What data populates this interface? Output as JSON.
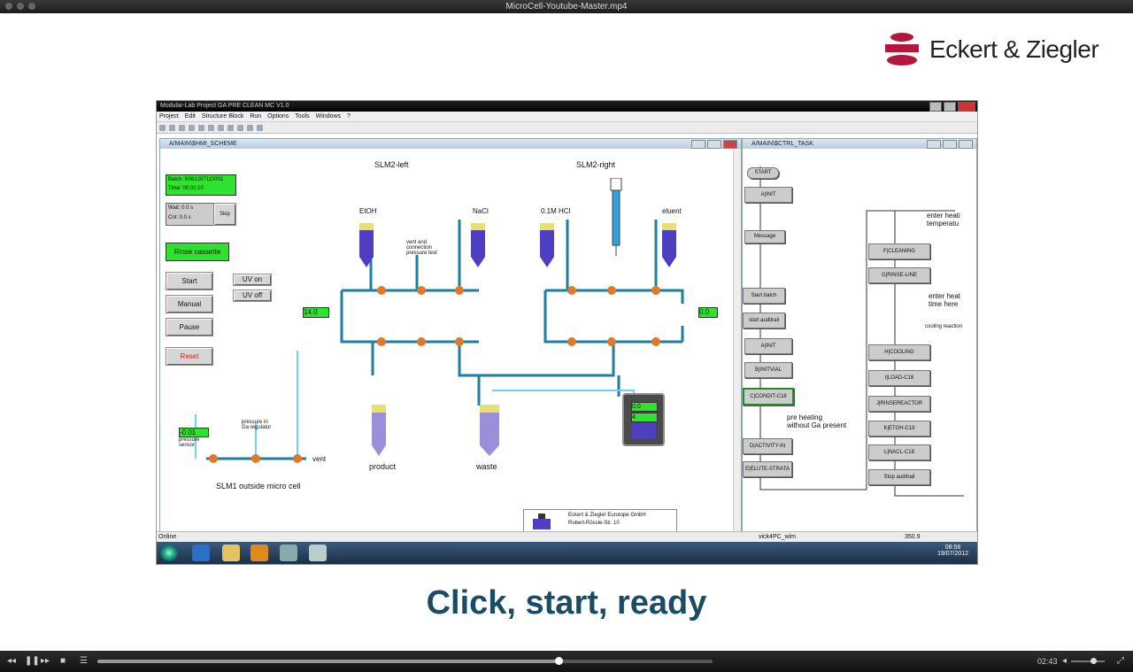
{
  "window": {
    "title": "MicroCell-Youtube-Master.mp4"
  },
  "brand": {
    "name": "Eckert & Ziegler",
    "color": "#b4173a"
  },
  "app": {
    "title": "Modular-Lab   Project GA PRE CLEAN MC V1.0",
    "menu": [
      "Project",
      "Edit",
      "Structure Block",
      "Run",
      "Options",
      "Tools",
      "Windows",
      "?"
    ],
    "scheme_panel_title": "A/MAIN\\$HMI_SCHEME",
    "task_panel_title": "A/MAIN\\$CTRL_TASK",
    "status_left": "Online",
    "status_mid": "vick4PC_wim",
    "status_right": "350.9"
  },
  "scheme": {
    "slm2_left": "SLM2-left",
    "slm2_right": "SLM2-right",
    "batch_line1": "Batch: B061207110001",
    "batch_line2": "Time:    00:01:10",
    "wait_label": "Wait:  0.0     s",
    "cnt_label": "Cnt:    0.0     s",
    "skip": "Skip",
    "rinse": "Rinse cassette",
    "start": "Start",
    "manual": "Manual",
    "pause": "Pause",
    "reset": "Reset",
    "uv_on": "UV on",
    "uv_off": "UV off",
    "etoh": "EtOH",
    "nacl": "NaCl",
    "hcl": "0.1M HCl",
    "eluent": "eluent",
    "vent_note": "vent and\nconnection\npressure test",
    "product": "product",
    "waste": "waste",
    "left_temp": "14.0",
    "right_temp": "0.0",
    "reactor_top": "0.0",
    "reactor_bottom": "4",
    "pressure_value": "-0.01",
    "pressure_sensor": "pressure\nsensor",
    "regulator": "pressure in\nGa regulator",
    "vent": "vent",
    "slm1": "SLM1 outside micro cell",
    "company1": "Eckert & Ziegler Eurotope GmbH",
    "company2": "Robert-Rössle-Str. 10"
  },
  "task": {
    "items_left": [
      "START",
      "A|INIT",
      "Message",
      "Start batch",
      "start auditrail",
      "A|INIT",
      "B|INITVIAL",
      "C|CONDIT-C18",
      "D|ACTIVITY-IN",
      "E|ELUTE-STRATA"
    ],
    "items_right": [
      "F|CLEANING",
      "G|RINSE-LINE",
      "H|COOLING",
      "I|LOAD-C18",
      "J|RINSEREACTOR",
      "K|ETOH-C18",
      "L|NACL-C18",
      "Stop auditrail"
    ],
    "note_heat": "enter heati\ntemperatu",
    "note_time": "enter heat\ntime here",
    "note_cool": "cooling reaction",
    "note_preheat": "pre heating\nwithout Ga present"
  },
  "tray": {
    "time": "08:58",
    "date": "19/07/2012"
  },
  "caption": "Click, start, ready",
  "player": {
    "time": "02:43",
    "progress": 0.75
  }
}
